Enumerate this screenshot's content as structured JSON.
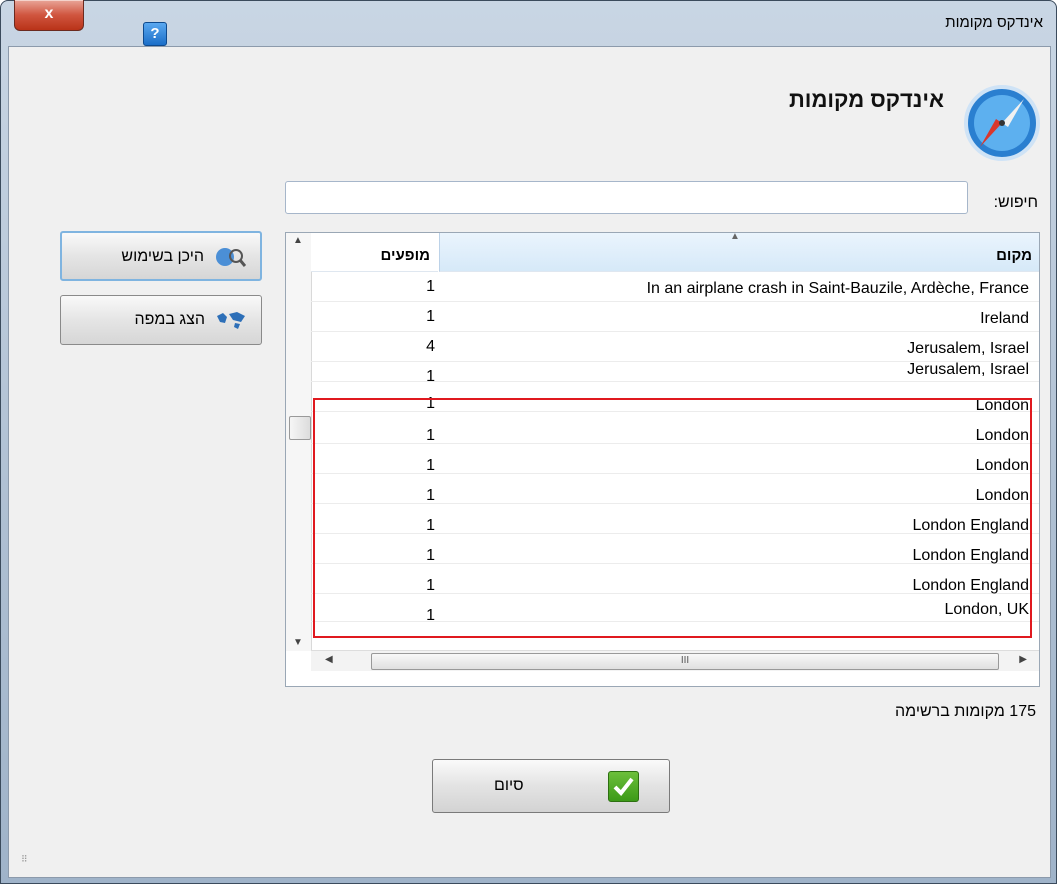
{
  "window": {
    "title": "אינדקס מקומות",
    "close_label": "x",
    "help_label": "?"
  },
  "dialog": {
    "heading": "אינדקס מקומות"
  },
  "search": {
    "label": "חיפוש:",
    "value": "",
    "placeholder": ""
  },
  "table": {
    "columns": {
      "place": "מקום",
      "count": "מופעים"
    },
    "rows": [
      {
        "place": "In an airplane crash in Saint-Bauzile, Ardèche, France",
        "count": "1"
      },
      {
        "place": "Ireland",
        "count": "1"
      },
      {
        "place": "Jerusalem, Israel",
        "count": "4"
      },
      {
        "place": "Jerusalem, Israel",
        "count": "1"
      },
      {
        "place": "London",
        "count": "1"
      },
      {
        "place": "London",
        "count": "1"
      },
      {
        "place": "London",
        "count": "1"
      },
      {
        "place": "London",
        "count": "1"
      },
      {
        "place": "London England",
        "count": "1"
      },
      {
        "place": "London England",
        "count": "1"
      },
      {
        "place": "London England",
        "count": "1"
      },
      {
        "place": "London, UK",
        "count": "1"
      }
    ],
    "hscroll_grip": "III"
  },
  "side_buttons": {
    "where_used": "היכן בשימוש",
    "show_map": "הצג במפה"
  },
  "status": "175 מקומות ברשימה",
  "finish_button": "סיום",
  "colors": {
    "highlight": "#e0191f",
    "accent": "#3c9a18"
  }
}
